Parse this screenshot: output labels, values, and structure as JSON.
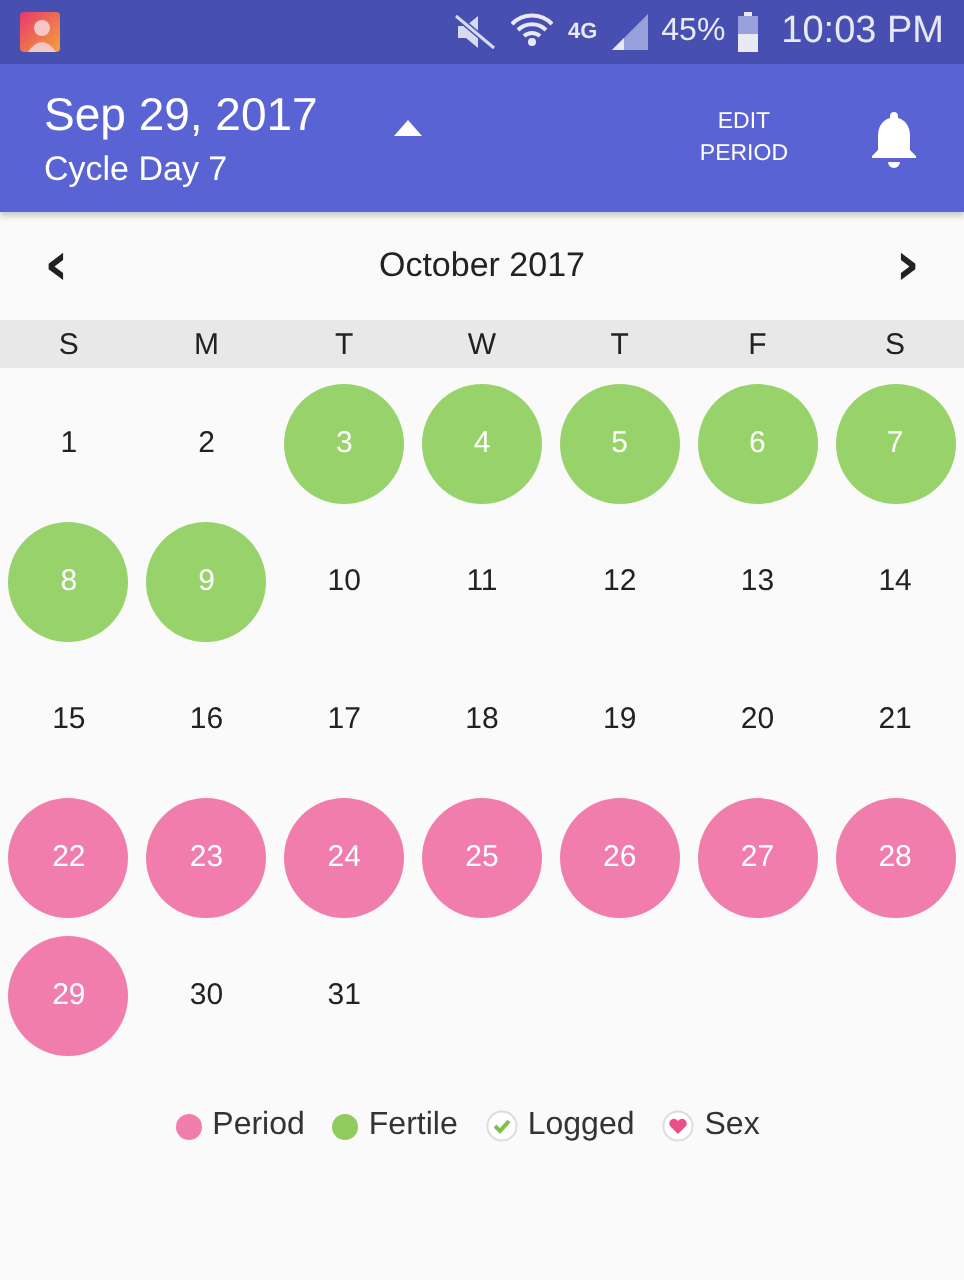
{
  "status_bar": {
    "network": "4G",
    "battery": "45%",
    "time": "10:03 PM"
  },
  "header": {
    "date": "Sep 29, 2017",
    "cycle_day": "Cycle Day 7",
    "expanded": true,
    "edit_button": "EDIT\nPERIOD"
  },
  "calendar": {
    "month": "October 2017",
    "prev": "‹",
    "next": "›",
    "weekdays": [
      "S",
      "M",
      "T",
      "W",
      "T",
      "F",
      "S"
    ],
    "days": [
      {
        "label": "1",
        "kind": "none"
      },
      {
        "label": "2",
        "kind": "none"
      },
      {
        "label": "3",
        "kind": "fertile"
      },
      {
        "label": "4",
        "kind": "fertile"
      },
      {
        "label": "5",
        "kind": "fertile"
      },
      {
        "label": "6",
        "kind": "fertile"
      },
      {
        "label": "7",
        "kind": "fertile"
      },
      {
        "label": "8",
        "kind": "fertile"
      },
      {
        "label": "9",
        "kind": "fertile"
      },
      {
        "label": "10",
        "kind": "none"
      },
      {
        "label": "11",
        "kind": "none"
      },
      {
        "label": "12",
        "kind": "none"
      },
      {
        "label": "13",
        "kind": "none"
      },
      {
        "label": "14",
        "kind": "none"
      },
      {
        "label": "15",
        "kind": "none"
      },
      {
        "label": "16",
        "kind": "none"
      },
      {
        "label": "17",
        "kind": "none"
      },
      {
        "label": "18",
        "kind": "none"
      },
      {
        "label": "19",
        "kind": "none"
      },
      {
        "label": "20",
        "kind": "none"
      },
      {
        "label": "21",
        "kind": "none"
      },
      {
        "label": "22",
        "kind": "period"
      },
      {
        "label": "23",
        "kind": "period"
      },
      {
        "label": "24",
        "kind": "period"
      },
      {
        "label": "25",
        "kind": "period"
      },
      {
        "label": "26",
        "kind": "period"
      },
      {
        "label": "27",
        "kind": "period"
      },
      {
        "label": "28",
        "kind": "period"
      },
      {
        "label": "29",
        "kind": "period"
      },
      {
        "label": "30",
        "kind": "none"
      },
      {
        "label": "31",
        "kind": "none"
      }
    ]
  },
  "legend": [
    {
      "label": "Period",
      "kind": "dot",
      "color": "#f07dab"
    },
    {
      "label": "Fertile",
      "kind": "dot",
      "color": "#8fcc5c"
    },
    {
      "label": "Logged",
      "kind": "check"
    },
    {
      "label": "Sex",
      "kind": "heart"
    }
  ]
}
